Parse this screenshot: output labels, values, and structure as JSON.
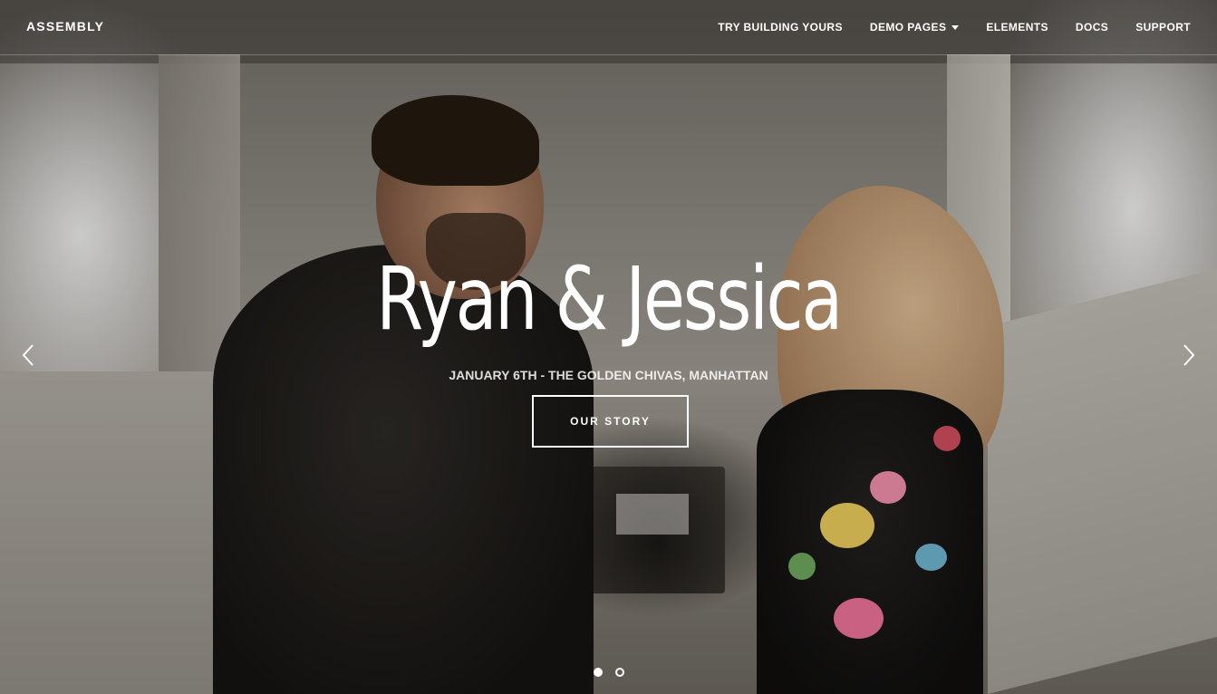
{
  "brand": {
    "name": "ASSEMBLY"
  },
  "nav": {
    "items": [
      {
        "label": "TRY BUILDING YOURS",
        "dropdown": false
      },
      {
        "label": "DEMO PAGES",
        "dropdown": true
      },
      {
        "label": "ELEMENTS",
        "dropdown": false
      },
      {
        "label": "DOCS",
        "dropdown": false
      },
      {
        "label": "SUPPORT",
        "dropdown": false
      }
    ]
  },
  "hero": {
    "title": "Ryan & Jessica",
    "subtitle": "JANUARY 6TH - THE GOLDEN CHIVAS, MANHATTAN",
    "cta_label": "OUR STORY",
    "slide_count": 2,
    "active_slide": 1,
    "prev_icon": "chevron-left-icon",
    "next_icon": "chevron-right-icon"
  },
  "colors": {
    "text": "#ffffff"
  }
}
